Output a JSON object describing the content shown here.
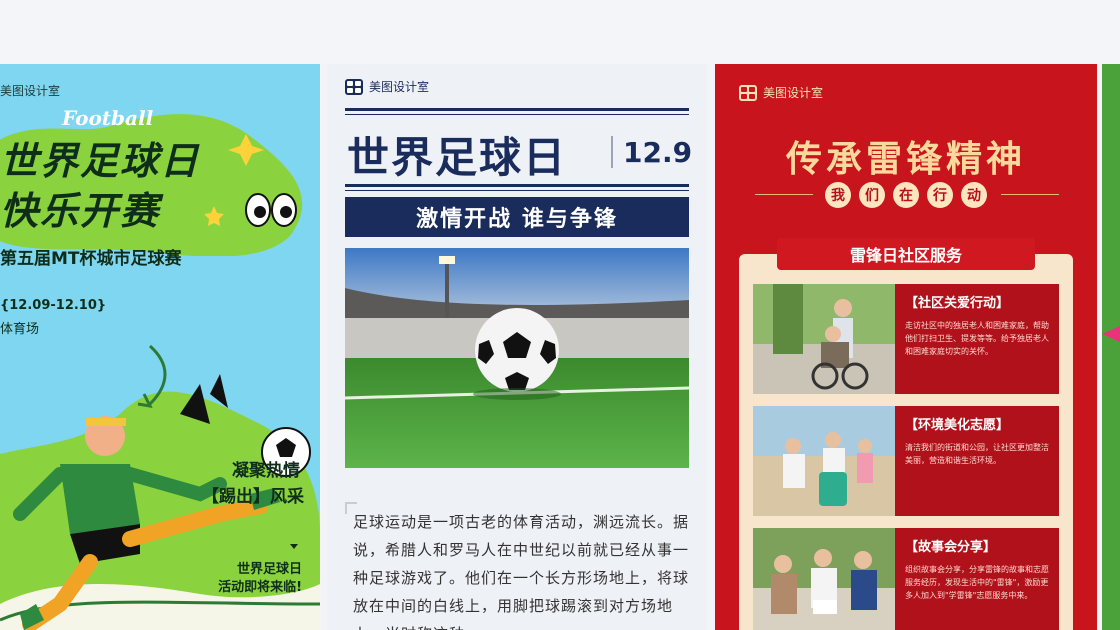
{
  "card1": {
    "brand": "美图设计室",
    "en_title": "Football",
    "title_line1": "世界足球日",
    "title_line2": "快乐开赛",
    "subtitle": "第五届MT杯城市足球赛",
    "date": "{12.09-12.10}",
    "venue": "体育场",
    "slogan1": "凝聚热情",
    "slogan2": "【踢出】风采",
    "tagline1": "世界足球日",
    "tagline2": "活动即将来临!",
    "colors": {
      "bg": "#7fd6f0",
      "green": "#8bd23f",
      "dark": "#0f2e1a"
    }
  },
  "card2": {
    "brand": "美图设计室",
    "title": "世界足球日",
    "date": "12.9",
    "banner": "激情开战  谁与争锋",
    "paragraph": "足球运动是一项古老的体育活动，渊远流长。据说，希腊人和罗马人在中世纪以前就已经从事一种足球游戏了。他们在一个长方形场地上，将球放在中间的白线上，用脚把球踢滚到对方场地上，当时称这种",
    "colors": {
      "navy": "#1a2c5b",
      "bg": "#eef1f6"
    }
  },
  "card3": {
    "brand": "美图设计室",
    "title": "传承雷锋精神",
    "pills": [
      "我",
      "们",
      "在",
      "行",
      "动"
    ],
    "ribbon": "雷锋日社区服务",
    "services": [
      {
        "heading": "【社区关爱行动】",
        "body": "走访社区中的独居老人和困难家庭，帮助他们打扫卫生、提发等等。给予独居老人和困难家庭切实的关怀。"
      },
      {
        "heading": "【环境美化志愿】",
        "body": "清洁我们的街道和公园，让社区更加整洁美丽，营造和谐生活环境。"
      },
      {
        "heading": "【故事会分享】",
        "body": "组织故事会分享，分享雷锋的故事和志愿服务经历，发现生活中的\"雷锋\"，激励更多人加入到\"学雷锋\"志愿服务中来。"
      }
    ],
    "colors": {
      "red": "#c8141c",
      "gold": "#f9d99c",
      "panel": "#f8e6cc"
    }
  }
}
